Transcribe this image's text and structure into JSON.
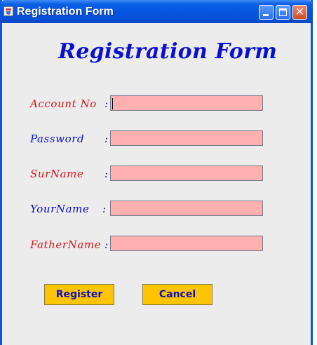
{
  "window": {
    "title": "Registration Form"
  },
  "form": {
    "heading": "Registration Form",
    "fields": [
      {
        "label": "Account No",
        "colon": ":",
        "value": ""
      },
      {
        "label": "Password",
        "colon": ":",
        "value": ""
      },
      {
        "label": "SurName",
        "colon": ":",
        "value": ""
      },
      {
        "label": "YourName",
        "colon": ":",
        "value": ""
      },
      {
        "label": "FatherName",
        "colon": ":",
        "value": ""
      }
    ],
    "register_label": "Register",
    "cancel_label": "Cancel"
  },
  "colors": {
    "heading": "#0a10d0",
    "label_red": "#d8141c",
    "label_blue": "#0a10c0",
    "field_background": "#ffb0b0",
    "button_background": "#ffc400"
  },
  "icons": {
    "app": "java-cup-icon",
    "minimize": "minimize-icon",
    "maximize": "maximize-icon",
    "close": "close-icon"
  }
}
